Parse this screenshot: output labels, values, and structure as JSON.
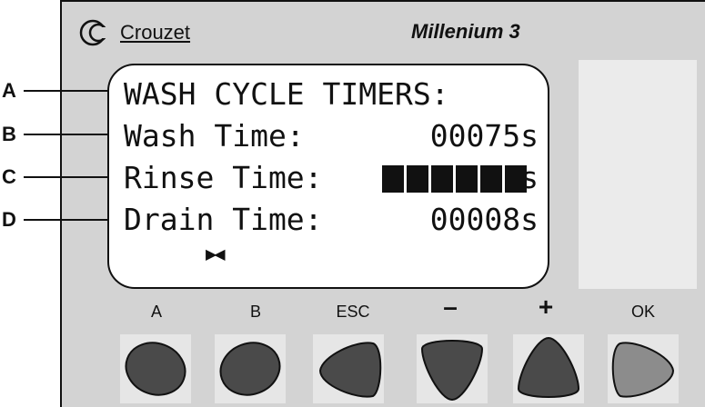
{
  "brand": {
    "name": "Crouzet",
    "model": "Millenium 3"
  },
  "callouts": [
    "A",
    "B",
    "C",
    "D"
  ],
  "lcd": {
    "title": "WASH CYCLE TIMERS:",
    "wash_label": "Wash Time:",
    "wash_value": "00075s",
    "rinse_label": "Rinse Time:",
    "rinse_unit": "s",
    "drain_label": "Drain Time:",
    "drain_value": "00008s",
    "cursor": "▶◀"
  },
  "buttons": [
    {
      "label": "A",
      "icon": "oval-button"
    },
    {
      "label": "B",
      "icon": "oval-button"
    },
    {
      "label": "ESC",
      "icon": "left-arrow-button"
    },
    {
      "label": "–",
      "icon": "down-arrow-button"
    },
    {
      "label": "+",
      "icon": "up-arrow-button"
    },
    {
      "label": "OK",
      "icon": "right-arrow-button"
    }
  ],
  "colors": {
    "panel": "#d3d3d3",
    "button_dark": "#4a4a4a",
    "button_ok": "#8c8c8c",
    "lcd_bg": "#ffffff"
  }
}
